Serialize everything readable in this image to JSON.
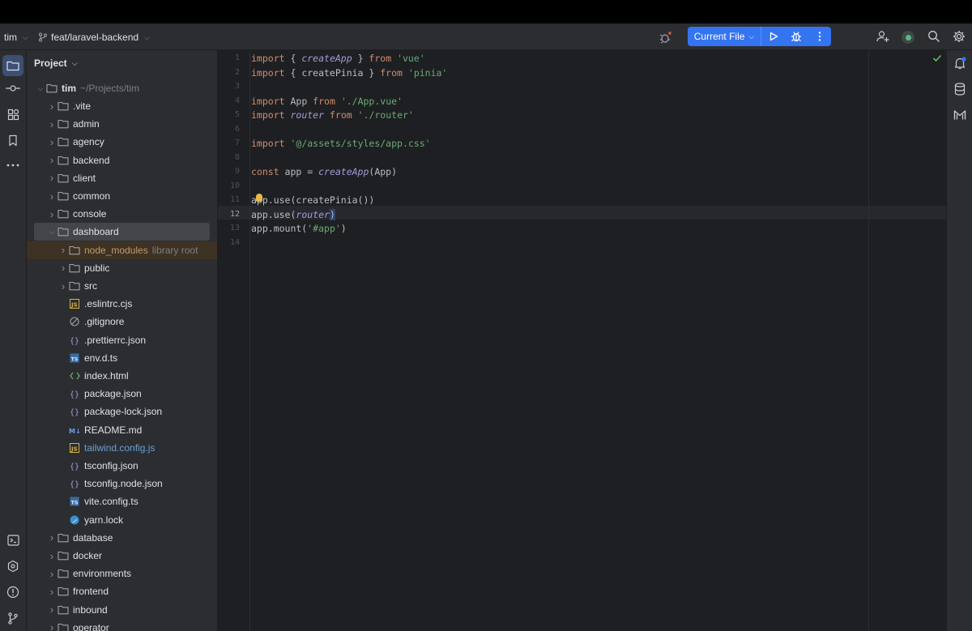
{
  "toolbar": {
    "project_name": "tim",
    "branch": "feat/laravel-backend",
    "run_config": "Current File"
  },
  "project_panel": {
    "title": "Project",
    "root": {
      "name": "tim",
      "path": "~/Projects/tim"
    },
    "tree": [
      {
        "name": ".vite",
        "kind": "folder",
        "depth": 1,
        "expanded": false
      },
      {
        "name": "admin",
        "kind": "folder",
        "depth": 1,
        "expanded": false
      },
      {
        "name": "agency",
        "kind": "folder",
        "depth": 1,
        "expanded": false
      },
      {
        "name": "backend",
        "kind": "folder",
        "depth": 1,
        "expanded": false
      },
      {
        "name": "client",
        "kind": "folder",
        "depth": 1,
        "expanded": false
      },
      {
        "name": "common",
        "kind": "folder",
        "depth": 1,
        "expanded": false
      },
      {
        "name": "console",
        "kind": "folder",
        "depth": 1,
        "expanded": false
      },
      {
        "name": "dashboard",
        "kind": "folder",
        "depth": 1,
        "expanded": true,
        "selected": true
      },
      {
        "name": "node_modules",
        "kind": "folder",
        "depth": 2,
        "expanded": false,
        "hint": "library root"
      },
      {
        "name": "public",
        "kind": "folder",
        "depth": 2,
        "expanded": false
      },
      {
        "name": "src",
        "kind": "folder",
        "depth": 2,
        "expanded": false
      },
      {
        "name": ".eslintrc.cjs",
        "kind": "js",
        "depth": 2
      },
      {
        "name": ".gitignore",
        "kind": "ignore",
        "depth": 2
      },
      {
        "name": ".prettierrc.json",
        "kind": "json",
        "depth": 2
      },
      {
        "name": "env.d.ts",
        "kind": "ts",
        "depth": 2
      },
      {
        "name": "index.html",
        "kind": "html",
        "depth": 2
      },
      {
        "name": "package.json",
        "kind": "json",
        "depth": 2
      },
      {
        "name": "package-lock.json",
        "kind": "json",
        "depth": 2
      },
      {
        "name": "README.md",
        "kind": "md",
        "depth": 2
      },
      {
        "name": "tailwind.config.js",
        "kind": "js",
        "depth": 2,
        "modified": true
      },
      {
        "name": "tsconfig.json",
        "kind": "json",
        "depth": 2
      },
      {
        "name": "tsconfig.node.json",
        "kind": "json",
        "depth": 2
      },
      {
        "name": "vite.config.ts",
        "kind": "ts",
        "depth": 2
      },
      {
        "name": "yarn.lock",
        "kind": "yarn",
        "depth": 2
      },
      {
        "name": "database",
        "kind": "folder",
        "depth": 1,
        "expanded": false
      },
      {
        "name": "docker",
        "kind": "folder",
        "depth": 1,
        "expanded": false
      },
      {
        "name": "environments",
        "kind": "folder",
        "depth": 1,
        "expanded": false
      },
      {
        "name": "frontend",
        "kind": "folder",
        "depth": 1,
        "expanded": false
      },
      {
        "name": "inbound",
        "kind": "folder",
        "depth": 1,
        "expanded": false
      },
      {
        "name": "operator",
        "kind": "folder",
        "depth": 1,
        "expanded": false
      }
    ]
  },
  "editor": {
    "current_line": 12,
    "lines": [
      {
        "n": "1",
        "tokens": [
          [
            "import",
            "kw"
          ],
          [
            " { ",
            ""
          ],
          [
            "createApp",
            "fn"
          ],
          [
            " } ",
            ""
          ],
          [
            "from",
            "kw"
          ],
          [
            " ",
            ""
          ],
          [
            "'vue'",
            "str"
          ]
        ]
      },
      {
        "n": "2",
        "tokens": [
          [
            "import",
            "kw"
          ],
          [
            " { createPinia } ",
            ""
          ],
          [
            "from",
            "kw"
          ],
          [
            " ",
            ""
          ],
          [
            "'pinia'",
            "str"
          ]
        ]
      },
      {
        "n": "3",
        "tokens": []
      },
      {
        "n": "4",
        "tokens": [
          [
            "import",
            "kw"
          ],
          [
            " App ",
            ""
          ],
          [
            "from",
            "kw"
          ],
          [
            " ",
            ""
          ],
          [
            "'./App.vue'",
            "str"
          ]
        ]
      },
      {
        "n": "5",
        "tokens": [
          [
            "import",
            "kw"
          ],
          [
            " ",
            ""
          ],
          [
            "router",
            "fn"
          ],
          [
            " ",
            ""
          ],
          [
            "from",
            "kw"
          ],
          [
            " ",
            ""
          ],
          [
            "'./router'",
            "str"
          ]
        ]
      },
      {
        "n": "6",
        "tokens": []
      },
      {
        "n": "7",
        "tokens": [
          [
            "import",
            "kw"
          ],
          [
            " ",
            ""
          ],
          [
            "'@/assets/styles/app.css'",
            "str"
          ]
        ]
      },
      {
        "n": "8",
        "tokens": []
      },
      {
        "n": "9",
        "tokens": [
          [
            "const",
            "kw"
          ],
          [
            " app = ",
            ""
          ],
          [
            "createApp",
            "fn"
          ],
          [
            "(App)",
            ""
          ]
        ]
      },
      {
        "n": "10",
        "tokens": []
      },
      {
        "n": "11",
        "tokens": [
          [
            "app.use(createPinia())",
            ""
          ]
        ]
      },
      {
        "n": "12",
        "tokens": [
          [
            "app.use(",
            ""
          ],
          [
            "router",
            "fn"
          ],
          [
            ")",
            "sel"
          ]
        ]
      },
      {
        "n": "13",
        "tokens": [
          [
            "app.mount(",
            ""
          ],
          [
            "'#app'",
            "str"
          ],
          [
            ")",
            ""
          ]
        ]
      },
      {
        "n": "14",
        "tokens": []
      }
    ]
  },
  "colors": {
    "accent": "#3574f0",
    "background": "#1e1f22",
    "panel": "#2b2d30",
    "keyword": "#cf8e6d",
    "function": "#a59bd9",
    "string": "#6aab73"
  },
  "icons": {
    "left_toolbar": [
      "folder-icon",
      "commit-icon",
      "structure-icon",
      "bookmarks-icon",
      "more-icon"
    ],
    "left_toolbar_bottom": [
      "terminal-icon",
      "services-icon",
      "problems-icon",
      "git-icon"
    ],
    "right_toolbar": [
      "notifications-icon",
      "database-icon",
      "gmail-icon"
    ],
    "toolbar_right": [
      "debug-status-icon",
      "run-icon",
      "debug-icon",
      "more-vertical-icon",
      "add-user-icon",
      "avatar",
      "search-icon",
      "settings-icon"
    ]
  }
}
